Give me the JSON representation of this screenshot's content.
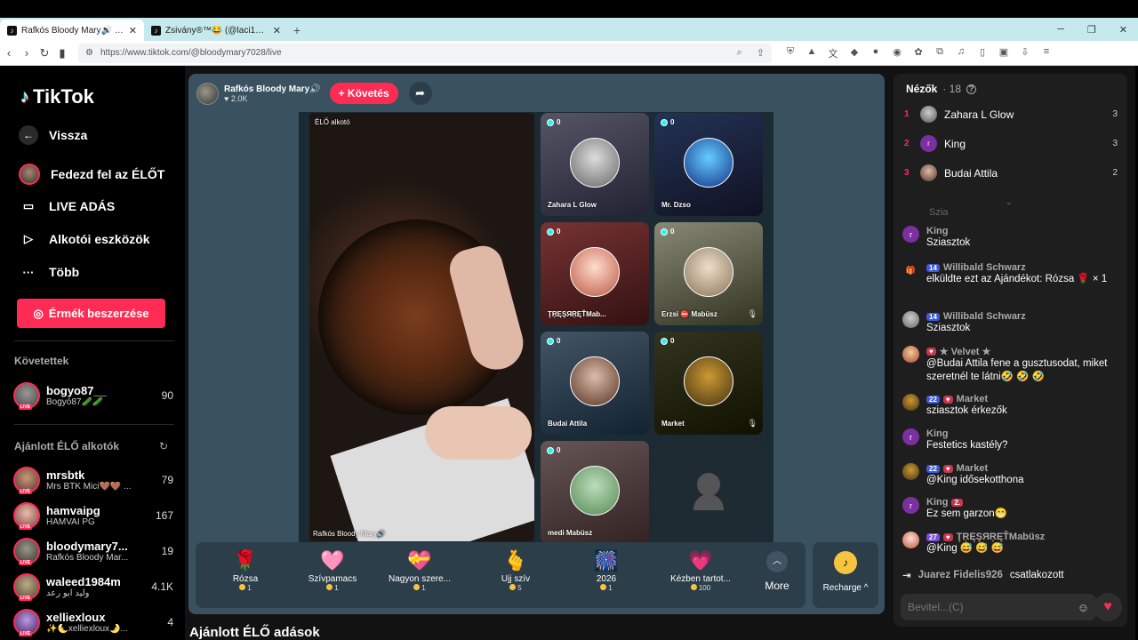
{
  "browser": {
    "tabs": [
      {
        "title": "Rafkós Bloody Mary🔊 (@blo",
        "active": true
      },
      {
        "title": "Zsivány®™😂 (@laci1918) ÉLŐ adás",
        "active": false
      }
    ],
    "url": "https://www.tiktok.com/@bloodymary7028/live"
  },
  "sidebar": {
    "logo": "TikTok",
    "back": "Vissza",
    "nav": [
      {
        "label": "Fedezd fel az ÉLŐT",
        "icon": "avatar-icon"
      },
      {
        "label": "LIVE ADÁS",
        "icon": "video-camera-icon"
      },
      {
        "label": "Alkotói eszközök",
        "icon": "creator-tools-icon"
      },
      {
        "label": "Több",
        "icon": "more-dots-icon"
      }
    ],
    "coins_button": "Érmék beszerzése",
    "following_title": "Követettek",
    "following": [
      {
        "name": "bogyo87__",
        "sub": "Bogyó87🥒🥒",
        "count": "90"
      }
    ],
    "recommended_title": "Ajánlott ÉLŐ alkotók",
    "recommended": [
      {
        "name": "mrsbtk",
        "sub": "Mrs BTK Mici🤎🤎 ...",
        "count": "79"
      },
      {
        "name": "hamvaipg",
        "sub": "HAMVAI PG",
        "count": "167"
      },
      {
        "name": "bloodymary7...",
        "sub": "Rafkós Bloody Mar...",
        "count": "19"
      },
      {
        "name": "waleed1984m",
        "sub": "وليد ابو رعد",
        "count": "4.1K"
      },
      {
        "name": "xelliexloux",
        "sub": "✨🌜xelliexloux🌛...",
        "count": "4"
      }
    ],
    "live_badge": "LIVE"
  },
  "stage": {
    "host_name": "Rafkós Bloody Mary🔊",
    "host_likes": "♥ 2.0K",
    "follow_label": "+ Követés",
    "main_tag": "ÉLŐ alkotó",
    "main_watermark": "Rafkós Bloody Mary🔊",
    "guests": [
      {
        "name": "Zahara L Glow",
        "count": "0",
        "muted": false
      },
      {
        "name": "Mr. Dzso",
        "count": "0",
        "muted": false
      },
      {
        "name": "ŢŖĘŞЯŖĘŤMab...",
        "count": "0",
        "muted": false
      },
      {
        "name": "Erzsi ⛔ Mabüsz",
        "count": "0",
        "muted": true
      },
      {
        "name": "Budai Attila",
        "count": "0",
        "muted": false
      },
      {
        "name": "Market",
        "count": "0",
        "muted": true
      },
      {
        "name": "medi Mabüsz",
        "count": "0",
        "muted": false
      }
    ],
    "gifts": [
      {
        "name": "Rózsa",
        "price": "1",
        "icon": "🌹"
      },
      {
        "name": "Szívpamacs",
        "price": "1",
        "icon": "🩷"
      },
      {
        "name": "Nagyon szere...",
        "price": "1",
        "icon": "💝"
      },
      {
        "name": "Ujj szív",
        "price": "5",
        "icon": "🫰"
      },
      {
        "name": "2026",
        "price": "1",
        "icon": "🎆"
      },
      {
        "name": "Kézben tartot...",
        "price": "100",
        "icon": "💗"
      }
    ],
    "more_label": "More",
    "recharge_label": "Recharge ^",
    "below_title": "Ajánlott ÉLŐ adások"
  },
  "chat": {
    "viewers_title": "Nézők",
    "viewers_count": "· 18",
    "viewers": [
      {
        "rank": "1",
        "name": "Zahara L Glow",
        "score": "3"
      },
      {
        "rank": "2",
        "name": "King",
        "score": "3"
      },
      {
        "rank": "3",
        "name": "Budai Attila",
        "score": "2"
      }
    ],
    "partial_top": "Szia",
    "messages": [
      {
        "user": "King",
        "badges": [],
        "text": "Sziasztok",
        "avatar": "K"
      },
      {
        "user": "Willibald Schwarz",
        "badges": [
          "14"
        ],
        "text": "elküldte ezt az Ajándékot: Rózsa 🌹 × 1",
        "avatar": "🎁"
      },
      {
        "user": "Willibald Schwarz",
        "badges": [
          "14"
        ],
        "text": "Sziasztok",
        "avatar": ""
      },
      {
        "user": "★ Velvet ★",
        "badges": [
          "♥"
        ],
        "text": "@Budai Attila fene a gusztusodat, miket szeretnél te látni🤣 🤣 🤣",
        "avatar": ""
      },
      {
        "user": "Market",
        "badges": [
          "22",
          "♥"
        ],
        "text": "sziasztok érkezők",
        "avatar": ""
      },
      {
        "user": "King",
        "badges": [],
        "text": "Festetics kastély?",
        "avatar": "K"
      },
      {
        "user": "Market",
        "badges": [
          "22",
          "♥"
        ],
        "text": "@King idősekotthona",
        "avatar": ""
      },
      {
        "user": "King",
        "badges": [
          "2."
        ],
        "text": "Ez sem garzon😁",
        "avatar": "K"
      },
      {
        "user": "ŢŖĘŞЯŖĘŤMabüsz",
        "badges": [
          "27",
          "♥"
        ],
        "text": "@King 😅 😅 😅",
        "avatar": ""
      }
    ],
    "join_user": "Juarez Fidelis926",
    "join_text": "csatlakozott",
    "input_placeholder": "Bevitel...(C)"
  }
}
